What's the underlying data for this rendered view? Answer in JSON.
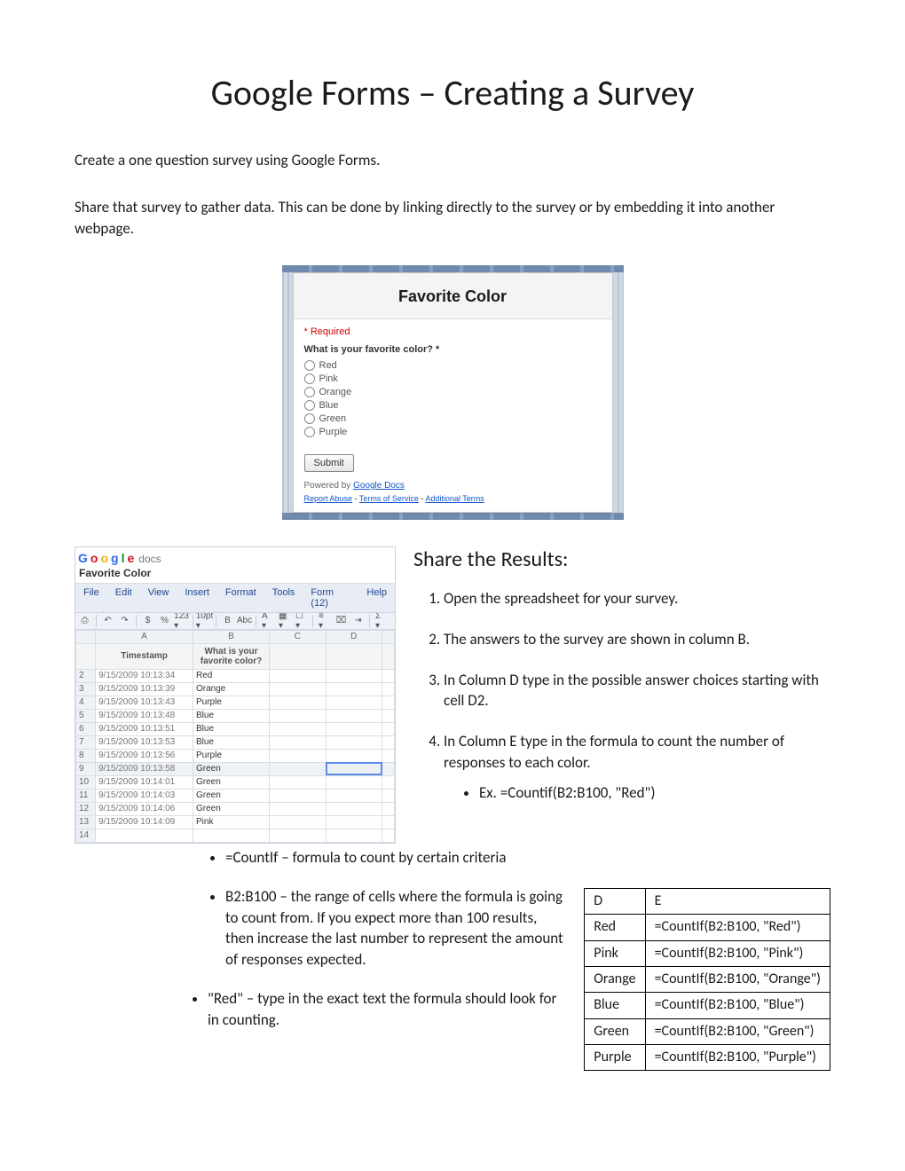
{
  "title": "Google Forms – Creating a Survey",
  "intro1": "Create a one question survey using Google Forms.",
  "intro2": "Share that survey to gather data.  This can be done by linking directly to the survey or by embedding it into another webpage.",
  "form": {
    "title": "Favorite Color",
    "required": "* Required",
    "question": "What is your favorite color? *",
    "options": [
      "Red",
      "Pink",
      "Orange",
      "Blue",
      "Green",
      "Purple"
    ],
    "submit": "Submit",
    "powered_prefix": "Powered by ",
    "powered_link": "Google Docs",
    "links": [
      "Report Abuse",
      "Terms of Service",
      "Additional Terms"
    ]
  },
  "sheet": {
    "logo_letters": [
      "G",
      "o",
      "o",
      "g",
      "l",
      "e"
    ],
    "logo_suffix": "docs",
    "docname": "Favorite Color",
    "menus": [
      "File",
      "Edit",
      "View",
      "Insert",
      "Format",
      "Tools",
      "Form (12)",
      "Help"
    ],
    "toolbar": [
      "⎙",
      "↶",
      "↷",
      "$",
      "%",
      "123 ▾",
      "10pt ▾",
      "B",
      "Abc",
      "A ▾",
      "▦ ▾",
      "☐ ▾",
      "≡ ▾",
      "⌧",
      "⇥",
      "Σ ▾"
    ],
    "cols": [
      "A",
      "B",
      "C",
      "D"
    ],
    "hdr_a": "Timestamp",
    "hdr_b": "What is your\nfavorite color?",
    "rows": [
      {
        "n": "2",
        "a": "9/15/2009 10:13:34",
        "b": "Red"
      },
      {
        "n": "3",
        "a": "9/15/2009 10:13:39",
        "b": "Orange"
      },
      {
        "n": "4",
        "a": "9/15/2009 10:13:43",
        "b": "Purple"
      },
      {
        "n": "5",
        "a": "9/15/2009 10:13:48",
        "b": "Blue"
      },
      {
        "n": "6",
        "a": "9/15/2009 10:13:51",
        "b": "Blue"
      },
      {
        "n": "7",
        "a": "9/15/2009 10:13:53",
        "b": "Blue"
      },
      {
        "n": "8",
        "a": "9/15/2009 10:13:56",
        "b": "Purple"
      },
      {
        "n": "9",
        "a": "9/15/2009 10:13:58",
        "b": "Green"
      },
      {
        "n": "10",
        "a": "9/15/2009 10:14:01",
        "b": "Green"
      },
      {
        "n": "11",
        "a": "9/15/2009 10:14:03",
        "b": "Green"
      },
      {
        "n": "12",
        "a": "9/15/2009 10:14:06",
        "b": "Green"
      },
      {
        "n": "13",
        "a": "9/15/2009 10:14:09",
        "b": "Pink"
      },
      {
        "n": "14",
        "a": "",
        "b": ""
      }
    ],
    "selected_row": "9",
    "selected_col": "D"
  },
  "share": {
    "heading": "Share the Results:",
    "steps": [
      "Open the spreadsheet for your survey.",
      "The answers to the survey are shown in column B.",
      "In Column D type in the possible answer choices starting with cell D2.",
      "In Column E type in the formula to count the number of responses to each color."
    ],
    "example": "Ex. =Countif(B2:B100, \"Red\")"
  },
  "explain": {
    "b1": "=CountIf – formula to count by certain criteria",
    "b2": "B2:B100 – the range of  cells where the formula is going to count from.  If you expect more than 100 results, then increase the last number to represent the amount of responses expected.",
    "b3": "\"Red\" – type in the exact text the formula should look for in counting."
  },
  "ftable": {
    "head": [
      "D",
      "E"
    ],
    "rows": [
      [
        "Red",
        "=CountIf(B2:B100, \"Red\")"
      ],
      [
        "Pink",
        "=CountIf(B2:B100, \"Pink\")"
      ],
      [
        "Orange",
        "=CountIf(B2:B100, \"Orange\")"
      ],
      [
        "Blue",
        "=CountIf(B2:B100, \"Blue\")"
      ],
      [
        "Green",
        "=CountIf(B2:B100, \"Green\")"
      ],
      [
        "Purple",
        "=CountIf(B2:B100, \"Purple\")"
      ]
    ]
  }
}
